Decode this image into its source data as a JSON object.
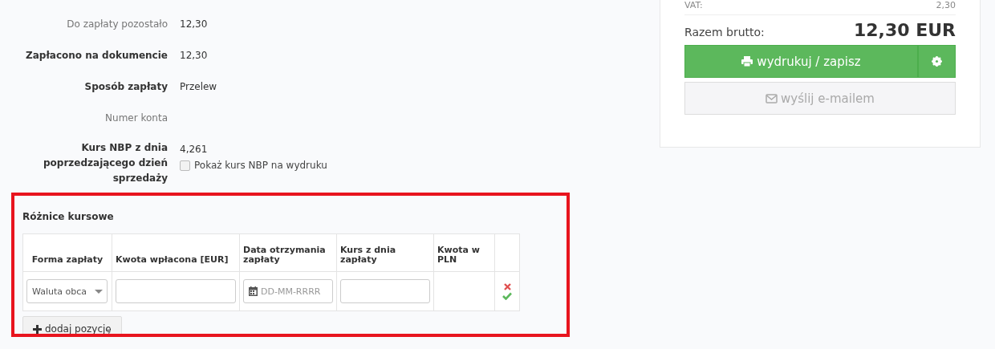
{
  "details": [
    {
      "label": "Do zapłaty pozostało",
      "emphasized": false,
      "value": "12,30"
    },
    {
      "label": "Zapłacono na dokumencie",
      "emphasized": true,
      "value": "12,30"
    },
    {
      "label": "Sposób zapłaty",
      "emphasized": true,
      "value": "Przelew"
    },
    {
      "label": "Numer konta",
      "emphasized": false
    },
    {
      "label": "Kurs NBP z dnia poprzedzającego dzień sprzedaży",
      "emphasized": true,
      "value": "4,261",
      "checkbox": {
        "label": "Pokaż kurs NBP na wydruku",
        "checked": false
      }
    }
  ],
  "exchange_differences": {
    "title": "Różnice kursowe",
    "columns": [
      "Forma zapłaty",
      "Kwota wpłacona [EUR]",
      "Data otrzymania zapłaty",
      "Kurs z dnia zapłaty",
      "Kwota w PLN"
    ],
    "row": {
      "payment_form": "Waluta obca",
      "date_placeholder": "DD-MM-RRRR"
    },
    "add_button": "dodaj pozycję"
  },
  "summary": {
    "vat_label": "VAT:",
    "vat_value": "2,30",
    "gross_label": "Razem brutto:",
    "gross_value": "12,30 EUR",
    "print_button": "wydrukuj / zapisz",
    "email_button": "wyślij e-mailem"
  }
}
